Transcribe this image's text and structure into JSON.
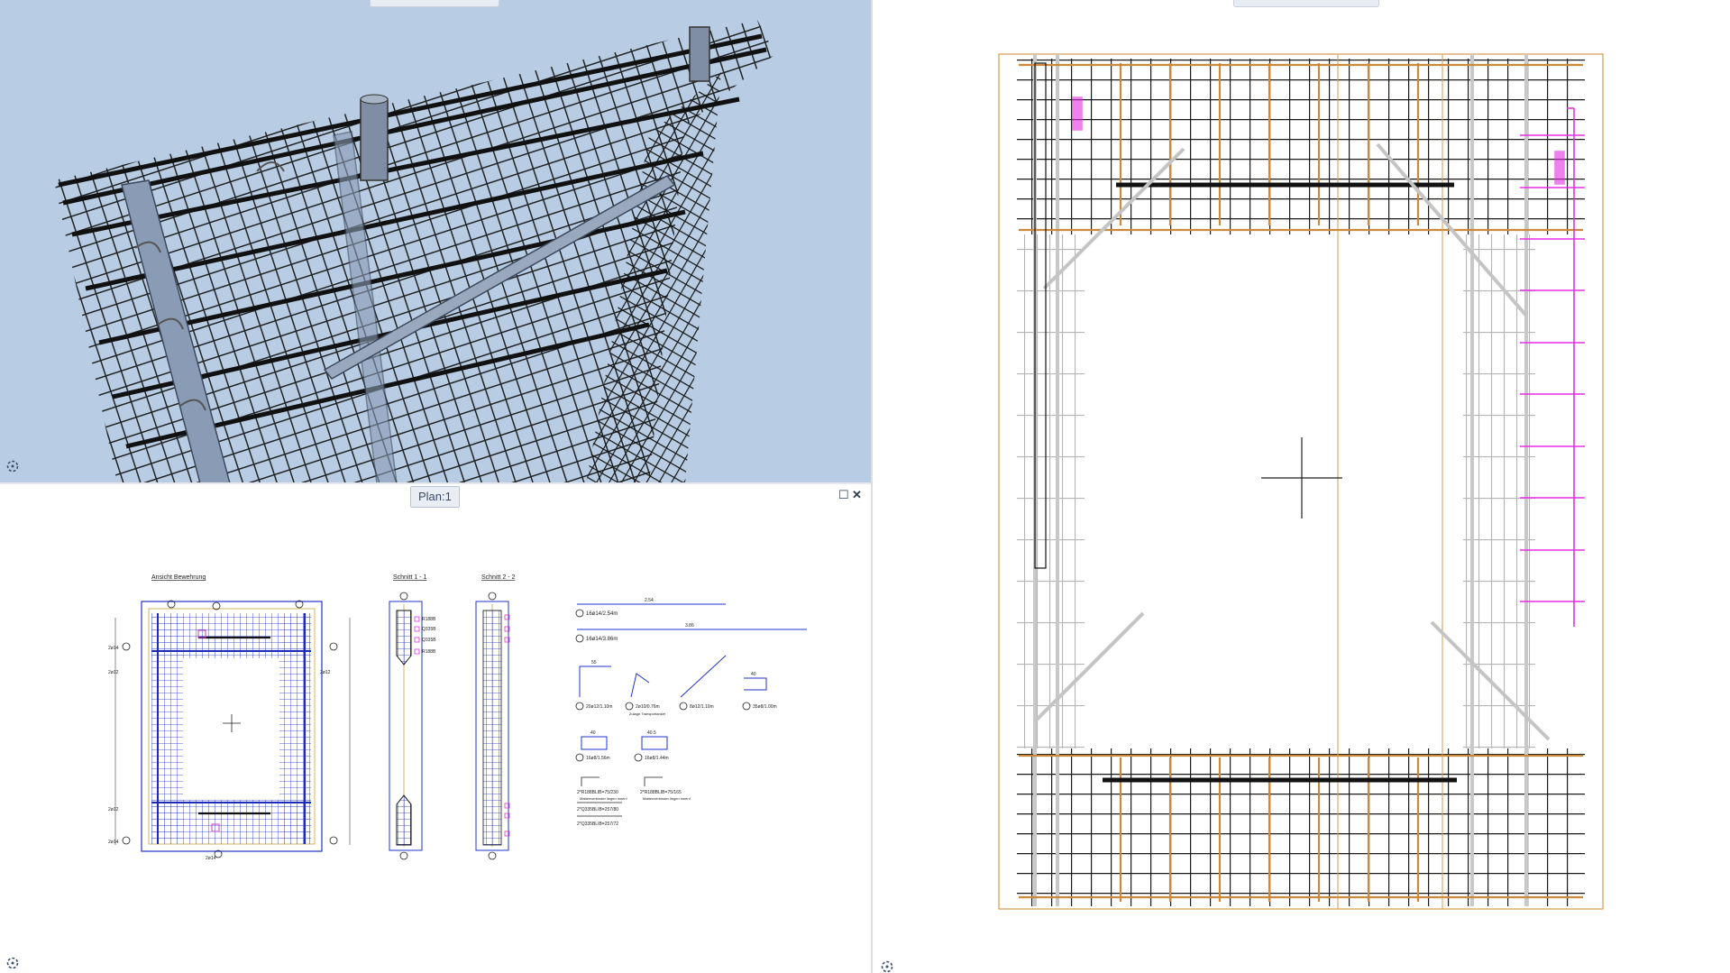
{
  "plan_tab": {
    "label": "Plan:1"
  },
  "window_controls": {
    "maximize": "☐",
    "close": "✕"
  },
  "drawing": {
    "view_titles": [
      "Ansicht Bewehrung",
      "Schnitt 1 - 1",
      "Schnitt 2 - 2"
    ],
    "bar_schedule": [
      {
        "pos": "4",
        "label": "16ø14/2.54m",
        "dim": "2.54"
      },
      {
        "pos": "5",
        "label": "16ø14/3.86m",
        "dim": "3.86"
      },
      {
        "pos": "1",
        "label": "20ø12/1.10m",
        "dim": "55"
      },
      {
        "pos": "2",
        "label": "2ø10/0.76m",
        "note": "Zulage Transportanker"
      },
      {
        "pos": "3",
        "label": "8ø12/1.10m"
      },
      {
        "pos": "6",
        "label": "35ø8/1.00m",
        "dim": "40"
      },
      {
        "pos": "7",
        "label": "16ø8/1.56m",
        "dim": "40"
      },
      {
        "pos": "8",
        "label": "16ø8/1.44m",
        "dim": "40.5"
      }
    ],
    "mesh_schedule": [
      {
        "label": "2*R188BLIB=75/230",
        "note": "Mattenverbinder liegen innen!"
      },
      {
        "label": "2*R188BLIB=75/165",
        "note": "Mattenverbinder liegen innen!"
      },
      {
        "label": "2*Q335BLIB=257/80"
      },
      {
        "label": "2*Q335BLIB=257/72"
      }
    ],
    "section_labels": [
      "R188B",
      "Q335B",
      "Q335B",
      "R188B"
    ],
    "bar_marks": [
      "2ø14",
      "2ø12",
      "2ø12",
      "2ø12",
      "2ø14",
      "2ø14"
    ]
  },
  "colors": {
    "viewport_bg": "#b8cde3",
    "rebar_dark": "#1c1c1c",
    "rebar_orange": "#c98a3c",
    "highlight_magenta": "#e62ee6",
    "plan_blue": "#1a2bbd"
  }
}
